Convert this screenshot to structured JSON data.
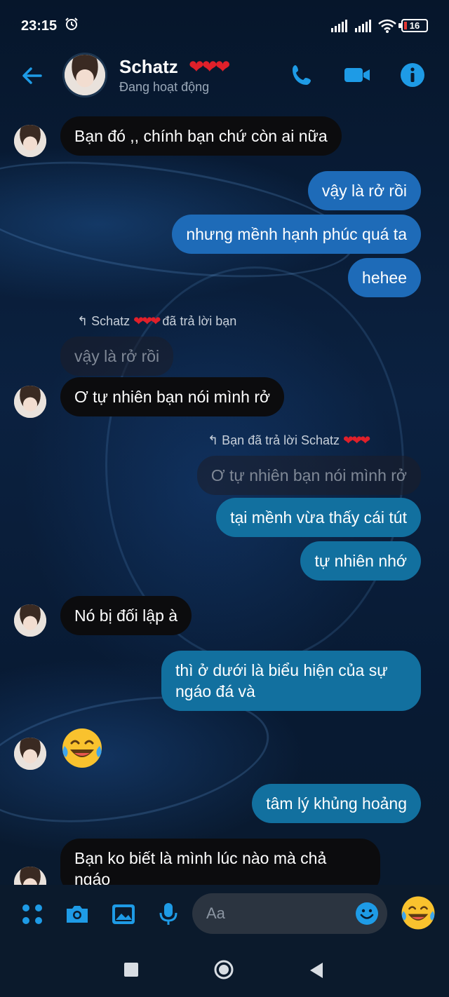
{
  "status_bar": {
    "time": "23:15",
    "battery": "16"
  },
  "header": {
    "name": "Schatz",
    "hearts": "❤❤❤",
    "status": "Đang hoạt động"
  },
  "messages": {
    "m1": "Bạn đó ,, chính bạn chứ còn ai nữa",
    "m2": "vậy là rở rồi",
    "m3": "nhưng mềnh hạnh phúc quá ta",
    "m4": "hehee",
    "reply1_note": "Schatz",
    "reply1_hearts": "❤❤❤",
    "reply1_suffix": "đã trả lời bạn",
    "reply1_quote": "vậy là rở rồi",
    "m5": "Ơ tự nhiên bạn nói mình rở",
    "reply2_note": "Bạn đã trả lời Schatz",
    "reply2_hearts": "❤❤❤",
    "reply2_quote": "Ơ tự nhiên bạn nói mình rở",
    "m6": "tại mềnh vừa thấy cái tút",
    "m7": "tự nhiên nhớ",
    "m8": "Nó bị đối lập à",
    "m9": "thì ở dưới là biểu hiện của sự ngáo đá và",
    "m10": "tâm lý khủng hoảng",
    "m11": "Bạn ko biết là mình lúc nào mà chả ngáo"
  },
  "composer": {
    "placeholder": "Aa"
  },
  "colors": {
    "accent": "#1e9be6",
    "heart": "#e0202a",
    "sent": "#1e6bb8"
  }
}
